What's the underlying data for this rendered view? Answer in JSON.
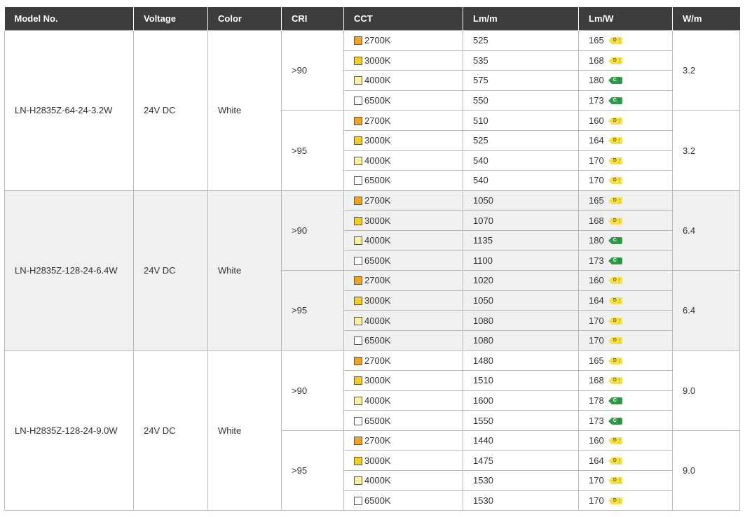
{
  "table": {
    "headers": [
      "Model No.",
      "Voltage",
      "Color",
      "CRI",
      "CCT",
      "Lm/m",
      "Lm/W",
      "W/m"
    ],
    "cct_colors": {
      "2700K": "#f0a51c",
      "3000K": "#f5d01a",
      "4000K": "#fbf29a",
      "6500K": "#ffffff"
    },
    "energy_class_colors": {
      "D": "#f4e14a",
      "C": "#2e9b48"
    },
    "groups": [
      {
        "model": "LN-H2835Z-64-24-3.2W",
        "voltage": "24V DC",
        "color": "White",
        "cri_blocks": [
          {
            "cri": ">90",
            "wm": "3.2",
            "rows": [
              {
                "cct": "2700K",
                "lmm": "525",
                "lmw": "165",
                "class": "D"
              },
              {
                "cct": "3000K",
                "lmm": "535",
                "lmw": "168",
                "class": "D"
              },
              {
                "cct": "4000K",
                "lmm": "575",
                "lmw": "180",
                "class": "C"
              },
              {
                "cct": "6500K",
                "lmm": "550",
                "lmw": "173",
                "class": "C"
              }
            ]
          },
          {
            "cri": ">95",
            "wm": "3.2",
            "rows": [
              {
                "cct": "2700K",
                "lmm": "510",
                "lmw": "160",
                "class": "D"
              },
              {
                "cct": "3000K",
                "lmm": "525",
                "lmw": "164",
                "class": "D"
              },
              {
                "cct": "4000K",
                "lmm": "540",
                "lmw": "170",
                "class": "D"
              },
              {
                "cct": "6500K",
                "lmm": "540",
                "lmw": "170",
                "class": "D"
              }
            ]
          }
        ]
      },
      {
        "model": "LN-H2835Z-128-24-6.4W",
        "voltage": "24V DC",
        "color": "White",
        "cri_blocks": [
          {
            "cri": ">90",
            "wm": "6.4",
            "rows": [
              {
                "cct": "2700K",
                "lmm": "1050",
                "lmw": "165",
                "class": "D"
              },
              {
                "cct": "3000K",
                "lmm": "1070",
                "lmw": "168",
                "class": "D"
              },
              {
                "cct": "4000K",
                "lmm": "1135",
                "lmw": "180",
                "class": "C"
              },
              {
                "cct": "6500K",
                "lmm": "1100",
                "lmw": "173",
                "class": "C"
              }
            ]
          },
          {
            "cri": ">95",
            "wm": "6.4",
            "rows": [
              {
                "cct": "2700K",
                "lmm": "1020",
                "lmw": "160",
                "class": "D"
              },
              {
                "cct": "3000K",
                "lmm": "1050",
                "lmw": "164",
                "class": "D"
              },
              {
                "cct": "4000K",
                "lmm": "1080",
                "lmw": "170",
                "class": "D"
              },
              {
                "cct": "6500K",
                "lmm": "1080",
                "lmw": "170",
                "class": "D"
              }
            ]
          }
        ]
      },
      {
        "model": "LN-H2835Z-128-24-9.0W",
        "voltage": "24V DC",
        "color": "White",
        "cri_blocks": [
          {
            "cri": ">90",
            "wm": "9.0",
            "rows": [
              {
                "cct": "2700K",
                "lmm": "1480",
                "lmw": "165",
                "class": "D"
              },
              {
                "cct": "3000K",
                "lmm": "1510",
                "lmw": "168",
                "class": "D"
              },
              {
                "cct": "4000K",
                "lmm": "1600",
                "lmw": "178",
                "class": "C"
              },
              {
                "cct": "6500K",
                "lmm": "1550",
                "lmw": "173",
                "class": "C"
              }
            ]
          },
          {
            "cri": ">95",
            "wm": "9.0",
            "rows": [
              {
                "cct": "2700K",
                "lmm": "1440",
                "lmw": "160",
                "class": "D"
              },
              {
                "cct": "3000K",
                "lmm": "1475",
                "lmw": "164",
                "class": "D"
              },
              {
                "cct": "4000K",
                "lmm": "1530",
                "lmw": "170",
                "class": "D"
              },
              {
                "cct": "6500K",
                "lmm": "1530",
                "lmw": "170",
                "class": "D"
              }
            ]
          }
        ]
      }
    ]
  }
}
